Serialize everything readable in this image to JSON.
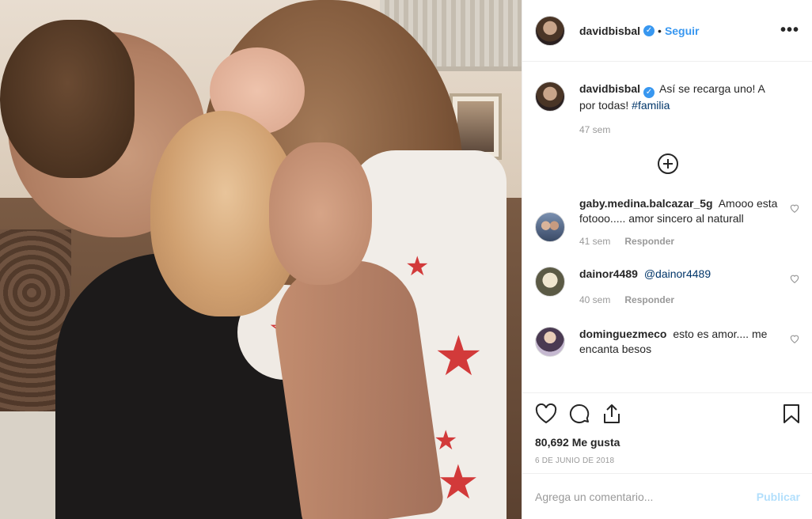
{
  "post": {
    "username": "davidbisbal",
    "verified_mark": "✓",
    "separator": "•",
    "follow_label": "Seguir",
    "more_label": "•••",
    "caption_text": "Así se recarga uno! A por todas!",
    "caption_hashtag": "#familia",
    "caption_time": "47 sem",
    "likes": "80,692 Me gusta",
    "date": "6 DE JUNIO DE 2018"
  },
  "comments": [
    {
      "user": "gaby.medina.balcazar_5g",
      "text": "Amooo esta fotooo..... amor sincero al naturall",
      "time": "41 sem",
      "reply": "Responder"
    },
    {
      "user": "dainor4489",
      "text": "@dainor4489",
      "time": "40 sem",
      "reply": "Responder"
    },
    {
      "user": "dominguezmeco",
      "text": "esto es amor.... me encanta besos",
      "time": "",
      "reply": ""
    }
  ],
  "add_comment": {
    "placeholder": "Agrega un comentario...",
    "publish_label": "Publicar"
  },
  "icons": {
    "like": "heart-icon",
    "comment": "comment-icon",
    "share": "share-icon",
    "save": "bookmark-icon",
    "load_more": "plus-circle-icon"
  },
  "colors": {
    "accent": "#3897f0",
    "muted": "#999999",
    "publish_disabled": "#b2dffc",
    "hashtag": "#003569"
  }
}
